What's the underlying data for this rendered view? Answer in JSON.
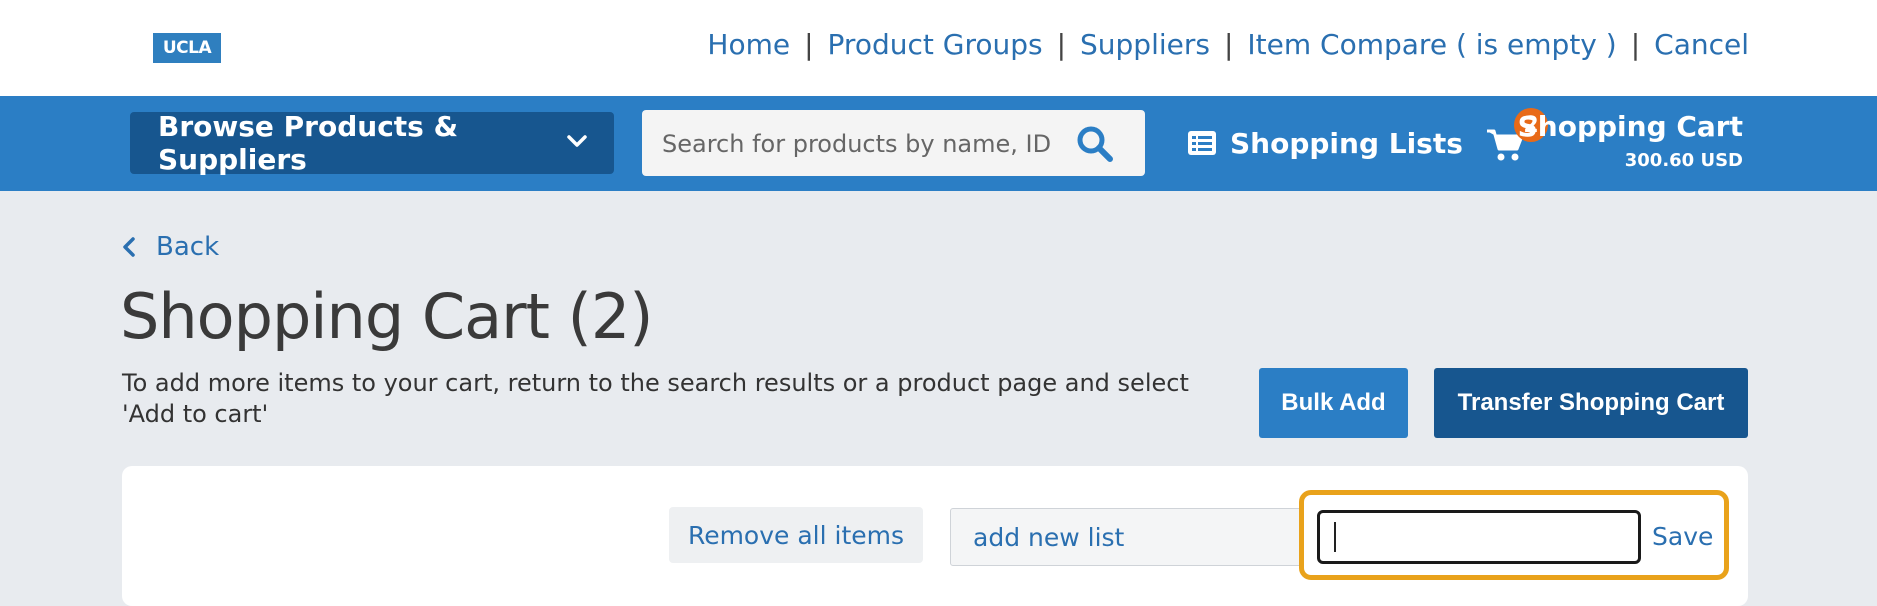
{
  "header": {
    "logo_text": "UCLA",
    "nav": {
      "home": "Home",
      "product_groups": "Product Groups",
      "suppliers": "Suppliers",
      "item_compare": "Item Compare ( is empty )",
      "cancel": "Cancel",
      "separator": "|"
    }
  },
  "toolbar": {
    "browse_label": "Browse Products & Suppliers",
    "search_placeholder": "Search for products by name, ID,",
    "shopping_lists_label": "Shopping Lists",
    "cart": {
      "badge_count": "2",
      "title": "Shopping Cart",
      "total": "300.60 USD"
    }
  },
  "main": {
    "back_label": "Back",
    "page_title": "Shopping Cart (2)",
    "help_text": "To add more items to your cart, return to the search results or a product page and select 'Add to cart'",
    "bulk_add_label": "Bulk Add",
    "transfer_label": "Transfer Shopping Cart",
    "remove_all_label": "Remove all items",
    "list_select_value": "add new list",
    "new_list_name_value": "",
    "save_label": "Save"
  },
  "colors": {
    "brand_blue": "#2b7ec5",
    "dark_blue": "#17568f",
    "link_blue": "#2a6fb0",
    "badge_orange": "#e86a18",
    "focus_ring": "#e9a21b",
    "page_bg": "#e8ebef"
  },
  "icons": [
    "chevron-down-icon",
    "search-icon",
    "list-icon",
    "cart-icon",
    "chevron-left-icon",
    "select-arrow-icon"
  ]
}
